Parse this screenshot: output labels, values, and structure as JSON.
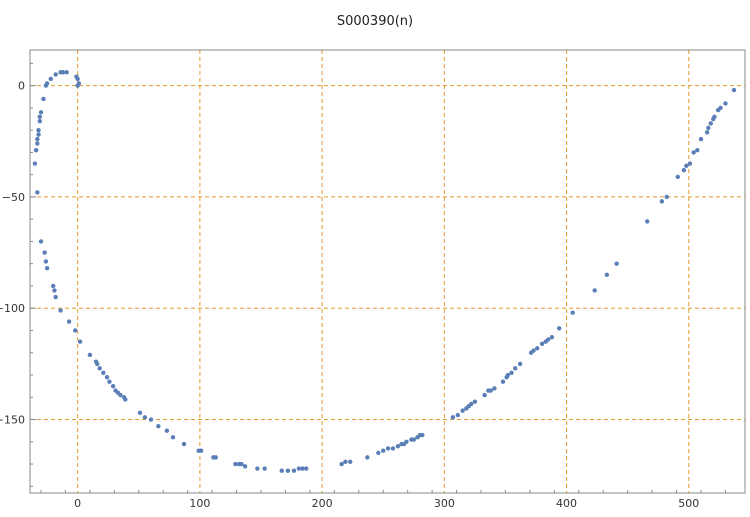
{
  "chart_data": {
    "type": "scatter",
    "title": "S000390(n)",
    "xlabel": "",
    "ylabel": "",
    "xlim": [
      -39,
      546
    ],
    "ylim": [
      -183,
      16
    ],
    "x_ticks": [
      0,
      100,
      200,
      300,
      400,
      500
    ],
    "y_ticks": [
      0,
      -50,
      -100,
      -150
    ],
    "grid": true,
    "grid_color": "#e69a2a",
    "point_color": "#5a7fb6",
    "series": [
      {
        "points": [
          [
            -35,
            -35
          ],
          [
            -34,
            -29
          ],
          [
            -33,
            -26
          ],
          [
            -33,
            -24
          ],
          [
            -32,
            -22
          ],
          [
            -32,
            -20
          ],
          [
            -31,
            -16
          ],
          [
            -31,
            -14
          ],
          [
            -30,
            -12
          ],
          [
            -28,
            -6
          ],
          [
            -26,
            0
          ],
          [
            -25,
            1
          ],
          [
            -22,
            3
          ],
          [
            -18,
            5
          ],
          [
            -14,
            6
          ],
          [
            -12,
            6
          ],
          [
            -9,
            6
          ],
          [
            -1,
            4
          ],
          [
            0,
            3
          ],
          [
            1,
            1
          ],
          [
            0,
            0
          ],
          [
            -33,
            -48
          ],
          [
            -30,
            -70
          ],
          [
            -27,
            -75
          ],
          [
            -26,
            -79
          ],
          [
            -25,
            -82
          ],
          [
            -20,
            -90
          ],
          [
            -19,
            -92
          ],
          [
            -18,
            -95
          ],
          [
            -14,
            -101
          ],
          [
            -7,
            -106
          ],
          [
            -2,
            -110
          ],
          [
            2,
            -115
          ],
          [
            10,
            -121
          ],
          [
            15,
            -124
          ],
          [
            16,
            -125
          ],
          [
            18,
            -127
          ],
          [
            21,
            -129
          ],
          [
            24,
            -131
          ],
          [
            26,
            -133
          ],
          [
            29,
            -135
          ],
          [
            31,
            -137
          ],
          [
            33,
            -138
          ],
          [
            35,
            -139
          ],
          [
            38,
            -140
          ],
          [
            39,
            -141
          ],
          [
            51,
            -147
          ],
          [
            55,
            -149
          ],
          [
            60,
            -150
          ],
          [
            66,
            -153
          ],
          [
            73,
            -155
          ],
          [
            78,
            -158
          ],
          [
            87,
            -161
          ],
          [
            99,
            -164
          ],
          [
            101,
            -164
          ],
          [
            111,
            -167
          ],
          [
            113,
            -167
          ],
          [
            129,
            -170
          ],
          [
            132,
            -170
          ],
          [
            134,
            -170
          ],
          [
            137,
            -171
          ],
          [
            147,
            -172
          ],
          [
            153,
            -172
          ],
          [
            167,
            -173
          ],
          [
            172,
            -173
          ],
          [
            177,
            -173
          ],
          [
            181,
            -172
          ],
          [
            184,
            -172
          ],
          [
            187,
            -172
          ],
          [
            216,
            -170
          ],
          [
            219,
            -169
          ],
          [
            223,
            -169
          ],
          [
            237,
            -167
          ],
          [
            246,
            -165
          ],
          [
            250,
            -164
          ],
          [
            254,
            -163
          ],
          [
            258,
            -163
          ],
          [
            262,
            -162
          ],
          [
            265,
            -161
          ],
          [
            267,
            -161
          ],
          [
            269,
            -160
          ],
          [
            273,
            -159
          ],
          [
            275,
            -159
          ],
          [
            278,
            -158
          ],
          [
            280,
            -157
          ],
          [
            282,
            -157
          ],
          [
            307,
            -149
          ],
          [
            311,
            -148
          ],
          [
            315,
            -146
          ],
          [
            318,
            -145
          ],
          [
            320,
            -144
          ],
          [
            322,
            -143
          ],
          [
            325,
            -142
          ],
          [
            333,
            -139
          ],
          [
            336,
            -137
          ],
          [
            338,
            -137
          ],
          [
            341,
            -136
          ],
          [
            348,
            -133
          ],
          [
            351,
            -131
          ],
          [
            352,
            -130
          ],
          [
            355,
            -129
          ],
          [
            358,
            -127
          ],
          [
            362,
            -125
          ],
          [
            371,
            -120
          ],
          [
            373,
            -119
          ],
          [
            376,
            -118
          ],
          [
            380,
            -116
          ],
          [
            383,
            -115
          ],
          [
            385,
            -114
          ],
          [
            388,
            -113
          ],
          [
            394,
            -109
          ],
          [
            405,
            -102
          ],
          [
            423,
            -92
          ],
          [
            433,
            -85
          ],
          [
            441,
            -80
          ],
          [
            466,
            -61
          ],
          [
            478,
            -52
          ],
          [
            482,
            -50
          ],
          [
            491,
            -41
          ],
          [
            496,
            -38
          ],
          [
            498,
            -36
          ],
          [
            501,
            -35
          ],
          [
            504,
            -30
          ],
          [
            507,
            -29
          ],
          [
            510,
            -24
          ],
          [
            515,
            -21
          ],
          [
            516,
            -19
          ],
          [
            518,
            -17
          ],
          [
            520,
            -15
          ],
          [
            521,
            -14
          ],
          [
            524,
            -11
          ],
          [
            526,
            -10
          ],
          [
            530,
            -8
          ],
          [
            537,
            -2
          ]
        ]
      }
    ]
  }
}
